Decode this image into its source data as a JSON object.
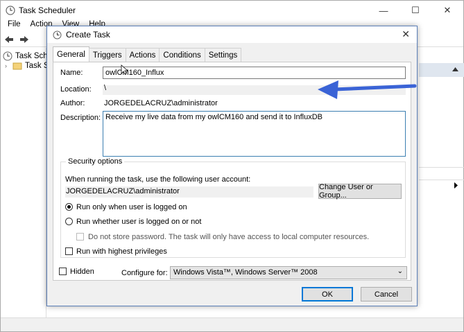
{
  "background_window": {
    "title": "Task Scheduler",
    "menu": [
      "File",
      "Action",
      "View",
      "Help"
    ],
    "tree": [
      "Task Sche",
      "Task Sc"
    ]
  },
  "dialog": {
    "title": "Create Task",
    "tabs": [
      "General",
      "Triggers",
      "Actions",
      "Conditions",
      "Settings"
    ],
    "general": {
      "name_label": "Name:",
      "name_value": "owlCM160_Influx",
      "location_label": "Location:",
      "location_value": "\\",
      "author_label": "Author:",
      "author_value": "JORGEDELACRUZ\\administrator",
      "description_label": "Description:",
      "description_value": "Receive my live data from my owlCM160 and send it to InfluxDB",
      "security": {
        "title": "Security options",
        "account_prompt": "When running the task, use the following user account:",
        "account_value": "JORGEDELACRUZ\\administrator",
        "change_button": "Change User or Group...",
        "radio_logged_on": "Run only when user is logged on",
        "radio_whether": "Run whether user is logged on or not",
        "no_store_password": "Do not store password.  The task will only have access to local computer resources.",
        "highest_privileges": "Run with highest privileges"
      },
      "hidden_label": "Hidden",
      "configure_label": "Configure for:",
      "configure_value": "Windows Vista™, Windows Server™ 2008"
    },
    "ok_button": "OK",
    "cancel_button": "Cancel"
  },
  "colors": {
    "arrow": "#3a63d6",
    "accent_border": "#5b7fb8"
  }
}
